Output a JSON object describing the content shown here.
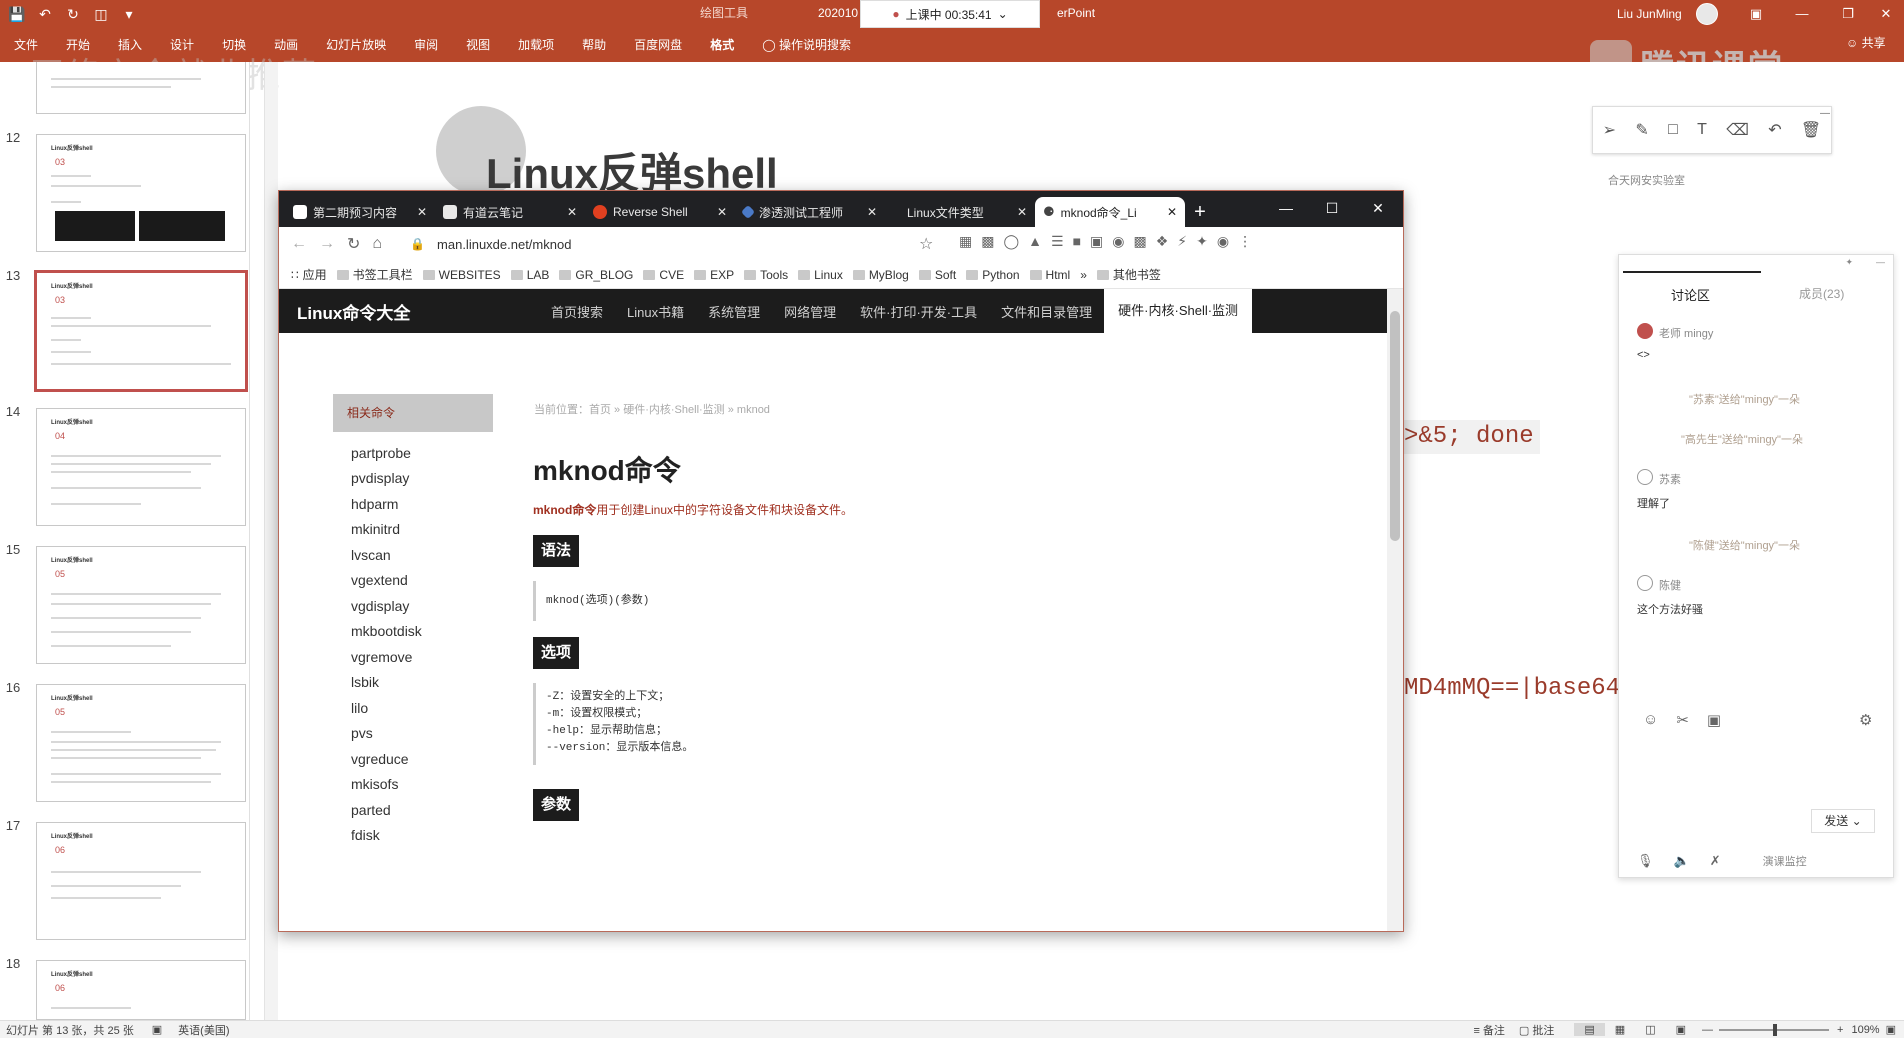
{
  "powerpoint": {
    "context_tool": "绘图工具",
    "doc_title_left": "202010",
    "doc_title_right": "erPoint",
    "timer": "上课中 00:35:41",
    "user": "Liu JunMing",
    "ribbon_tabs": [
      "文件",
      "开始",
      "插入",
      "设计",
      "切换",
      "动画",
      "幻灯片放映",
      "审阅",
      "视图",
      "加载项",
      "帮助",
      "百度网盘",
      "格式"
    ],
    "tell_me": "操作说明搜索",
    "share": "共享",
    "watermark_left": "网络安全就业推荐",
    "watermark_right": "腾讯课堂"
  },
  "slides": {
    "items": [
      {
        "num": "12",
        "title": "Linux反弹shell",
        "sub": "03"
      },
      {
        "num": "13",
        "title": "Linux反弹shell",
        "sub": "03"
      },
      {
        "num": "14",
        "title": "Linux反弹shell",
        "sub": "04"
      },
      {
        "num": "15",
        "title": "Linux反弹shell",
        "sub": "05"
      },
      {
        "num": "16",
        "title": "Linux反弹shell",
        "sub": "05"
      },
      {
        "num": "17",
        "title": "Linux反弹shell",
        "sub": "06"
      },
      {
        "num": "18",
        "title": "Linux反弹shell",
        "sub": "06"
      }
    ]
  },
  "slide": {
    "title": "Linux反弹shell",
    "code_fragment_1": ">&5; done",
    "code_fragment_2": "MD4mMQ==|base64"
  },
  "annotation": {
    "lab_logo": "合天网安实验室"
  },
  "discussion": {
    "tab": "讨论区",
    "members": "成员(23)",
    "messages": [
      {
        "user": "老师 mingy",
        "text": "<>"
      },
      {
        "flower": "\"苏素\"送给\"mingy\"一朵"
      },
      {
        "flower": "\"高先生\"送给\"mingy\"一朵"
      },
      {
        "user": "苏素",
        "text": "理解了"
      },
      {
        "flower": "\"陈健\"送给\"mingy\"一朵"
      },
      {
        "user": "陈健",
        "text": "这个方法好骚"
      }
    ],
    "send": "发送",
    "monitor": "演课监控"
  },
  "browser": {
    "tabs": [
      {
        "label": "第二期预习内容",
        "color": "#ffffff"
      },
      {
        "label": "有道云笔记",
        "color": "#e8e8e8"
      },
      {
        "label": "Reverse Shell",
        "color": "#e04020"
      },
      {
        "label": "渗透测试工程师",
        "color": "#4a7ac8"
      },
      {
        "label": "Linux文件类型",
        "color": "#202124"
      },
      {
        "label": "mknod命令_Li",
        "color": "#202124"
      }
    ],
    "url": "man.linuxde.net/mknod",
    "bookmarks": [
      "应用",
      "书签工具栏",
      "WEBSITES",
      "LAB",
      "GR_BLOG",
      "CVE",
      "EXP",
      "Tools",
      "Linux",
      "MyBlog",
      "Soft",
      "Python",
      "Html",
      "»",
      "其他书签"
    ]
  },
  "page": {
    "logo": "Linux命令大全",
    "nav": [
      "首页搜索",
      "Linux书籍",
      "系统管理",
      "网络管理",
      "软件·打印·开发·工具",
      "文件和目录管理",
      "硬件·内核·Shell·监测"
    ],
    "sidebar_title": "相关命令",
    "commands": [
      "partprobe",
      "pvdisplay",
      "hdparm",
      "mkinitrd",
      "lvscan",
      "vgextend",
      "vgdisplay",
      "mkbootdisk",
      "vgremove",
      "lsbik",
      "lilo",
      "pvs",
      "vgreduce",
      "mkisofs",
      "parted",
      "fdisk"
    ],
    "breadcrumb": "当前位置：首页 » 硬件·内核·Shell·监测 » mknod",
    "heading": "mknod命令",
    "description_cmd": "mknod命令",
    "description": "用于创建Linux中的字符设备文件和块设备文件。",
    "sec_syntax": "语法",
    "syntax": "mknod(选项)(参数)",
    "sec_options": "选项",
    "options": [
      "-Z：设置安全的上下文；",
      "-m：设置权限模式；",
      "-help：显示帮助信息；",
      "--version：显示版本信息。"
    ],
    "sec_params": "参数"
  },
  "statusbar": {
    "slide_info": "幻灯片 第 13 张，共 25 张",
    "language": "英语(美国)",
    "notes": "备注",
    "comments": "批注",
    "zoom": "109%"
  }
}
